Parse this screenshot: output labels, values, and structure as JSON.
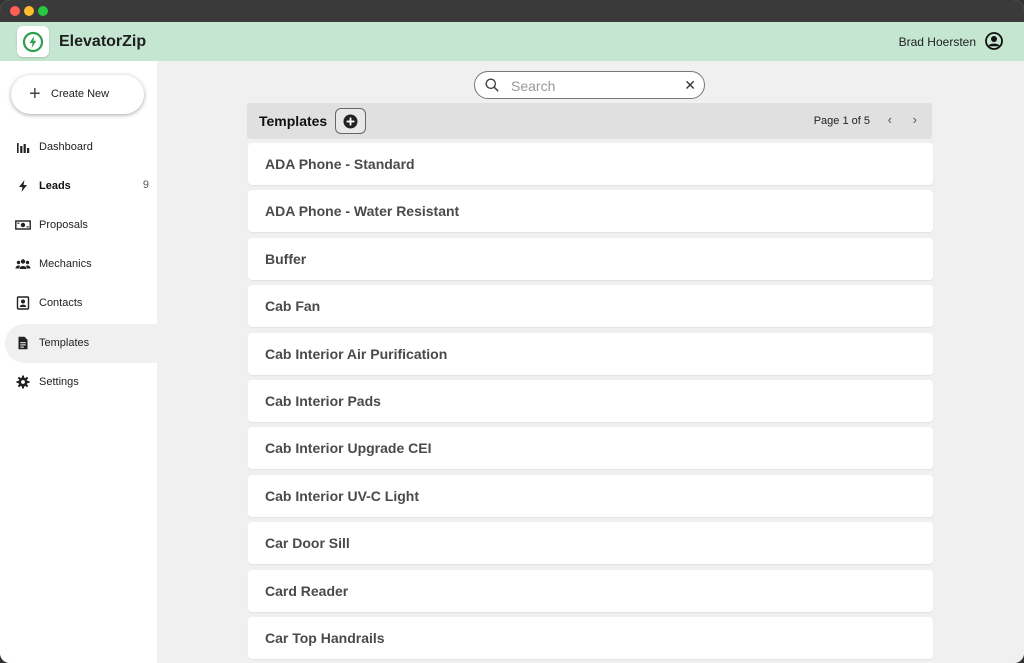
{
  "app": {
    "name": "ElevatorZip",
    "user_name": "Brad Hoersten",
    "accent_color": "#c5e6d0",
    "brand_green": "#2e9e4f"
  },
  "sidebar": {
    "create_label": "Create New",
    "items": [
      {
        "label": "Dashboard",
        "icon": "bar-chart-icon"
      },
      {
        "label": "Leads",
        "icon": "bolt-icon",
        "count": "9"
      },
      {
        "label": "Proposals",
        "icon": "money-icon"
      },
      {
        "label": "Mechanics",
        "icon": "group-icon"
      },
      {
        "label": "Contacts",
        "icon": "contact-card-icon"
      },
      {
        "label": "Templates",
        "icon": "document-icon",
        "active": true
      },
      {
        "label": "Settings",
        "icon": "gear-icon"
      }
    ]
  },
  "search": {
    "placeholder": "Search",
    "value": ""
  },
  "templates": {
    "title": "Templates",
    "page_text": "Page 1 of 5",
    "items": [
      "ADA Phone - Standard",
      "ADA Phone - Water Resistant",
      "Buffer",
      "Cab Fan",
      "Cab Interior Air Purification",
      "Cab Interior Pads",
      "Cab Interior Upgrade CEI",
      "Cab Interior UV-C Light",
      "Car Door Sill",
      "Card Reader",
      "Car Top Handrails"
    ]
  }
}
